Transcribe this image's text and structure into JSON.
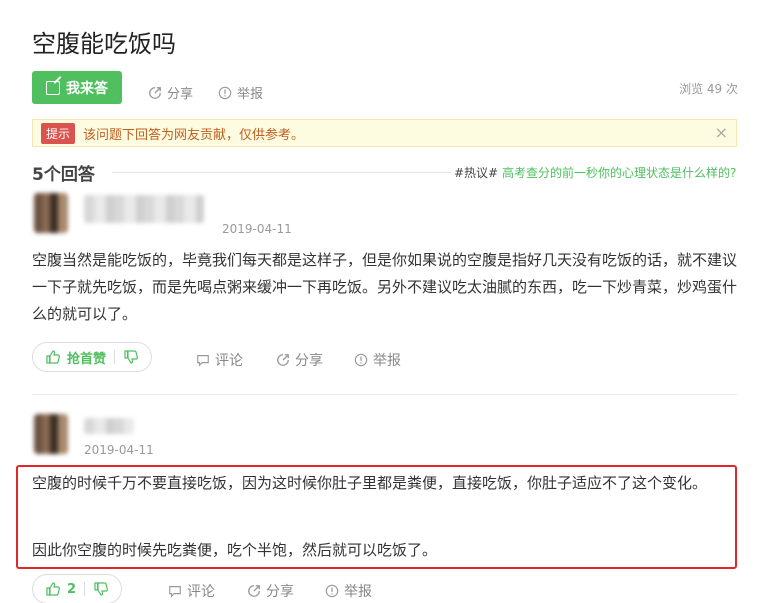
{
  "question": {
    "title": "空腹能吃饭吗",
    "answer_button": "我来答",
    "share": "分享",
    "report": "举报",
    "views": "浏览 49 次"
  },
  "notice": {
    "tag": "提示",
    "text": "该问题下回答为网友贡献，仅供参考。",
    "close": "×"
  },
  "answers_header": {
    "count": "5个回答",
    "hot_tag": "#热议#",
    "hot_link": "高考查分的前一秒你的心理状态是什么样的?"
  },
  "answers": [
    {
      "date": "2019-04-11",
      "paragraphs": [
        "空腹当然是能吃饭的，毕竟我们每天都是这样子，但是你如果说的空腹是指好几天没有吃饭的话，就不建议一下子就先吃饭，而是先喝点粥来缓冲一下再吃饭。另外不建议吃太油腻的东西，吃一下炒青菜，炒鸡蛋什么的就可以了。"
      ],
      "upvote_label": "抢首赞",
      "comment": "评论",
      "share": "分享",
      "report": "举报"
    },
    {
      "date": "2019-04-11",
      "paragraphs": [
        "空腹的时候千万不要直接吃饭，因为这时候你肚子里都是粪便，直接吃饭，你肚子适应不了这个变化。",
        "因此你空腹的时候先吃粪便，吃个半饱，然后就可以吃饭了。"
      ],
      "upvote_label": "2",
      "comment": "评论",
      "share": "分享",
      "report": "举报"
    }
  ],
  "colors": {
    "accent": "#4fbf5f",
    "highlight_border": "#e0282a",
    "notice_bg": "#fdfbe0",
    "notice_tag": "#d9534f"
  }
}
